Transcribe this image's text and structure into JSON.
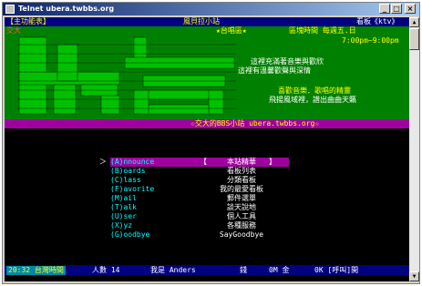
{
  "window": {
    "title": "Telnet ubera.twbbs.org",
    "min_glyph": "_",
    "max_glyph": "□",
    "close_glyph": "×"
  },
  "scrollbar": {
    "up_glyph": "▲",
    "down_glyph": "▼"
  },
  "header": {
    "left": "【主功能表】",
    "center": "風貝拉小站",
    "right": "看板《ktv》"
  },
  "banner": {
    "corner_left": "交大",
    "hot_label": "★台唱區★",
    "time_label": "區塊時間 每週五.日",
    "time_range": "7:00pm~9:00pm",
    "line1": "這裡充滿著音樂與歡欣",
    "line2": "這裡有溫馨歡聲與深情",
    "line3": "喜歡音樂．歌唱的精靈",
    "line4": "飛揚風域裡，譜出曲曲天籟",
    "footer": "☆交大的BBS小站 ubera.twbbs.org☆"
  },
  "menu": {
    "cursor": "＞",
    "items": [
      {
        "key": "(A)nnounce",
        "desc": "本站精華"
      },
      {
        "key": "(B)oards",
        "desc": "看板列表"
      },
      {
        "key": "(C)lass",
        "desc": "分類看板"
      },
      {
        "key": "(F)avorite",
        "desc": "我的最愛看板"
      },
      {
        "key": "(M)ail",
        "desc": "郵件選單"
      },
      {
        "key": "(T)alk",
        "desc": "談天說地"
      },
      {
        "key": "(U)ser",
        "desc": "個人工具"
      },
      {
        "key": "(X)yz",
        "desc": "各種服務"
      },
      {
        "key": "(G)oodbye",
        "desc": "SayGoodbye"
      }
    ],
    "bracket_open": "【",
    "bracket_close": "】"
  },
  "status": {
    "time": "20:32 台灣時間",
    "users": "人數 14",
    "me": "我是 Anders",
    "money": "錢",
    "zero_m": "0M 金",
    "zero_k": "0K [呼叫]開"
  },
  "colors": {
    "banner_green": "#008000",
    "banner_purple": "#a000a0",
    "header_blue": "#000080",
    "highlight": "#ffff00"
  }
}
